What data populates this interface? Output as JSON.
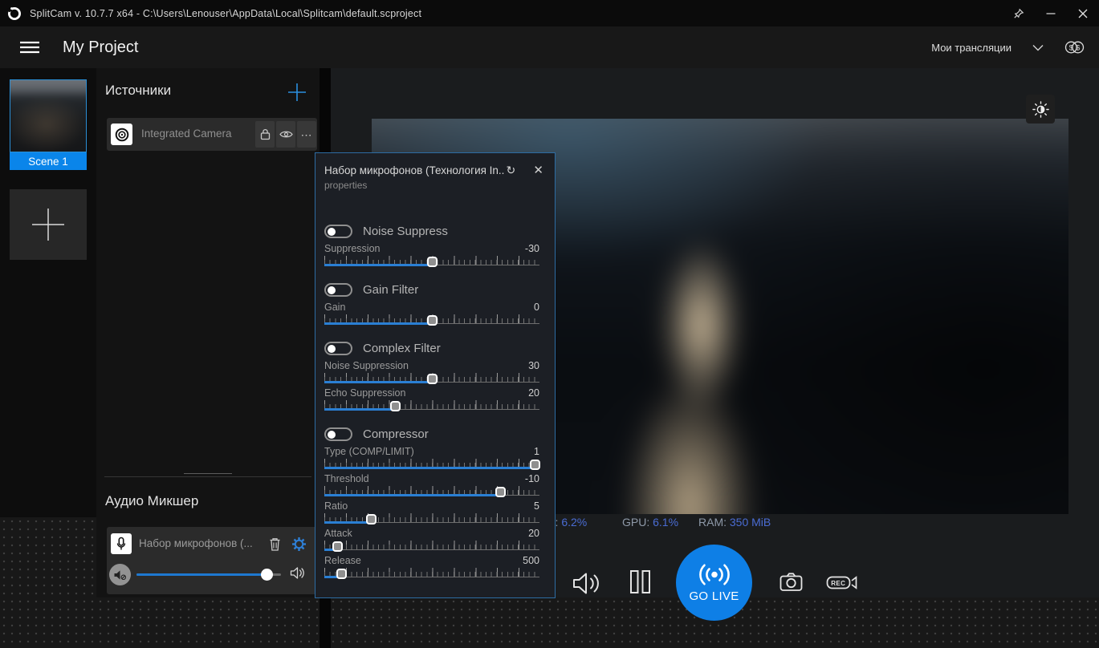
{
  "window": {
    "title": "SplitCam v. 10.7.7 x64 - C:\\Users\\Lenouser\\AppData\\Local\\Splitcam\\default.scproject"
  },
  "header": {
    "title": "My Project",
    "streams_label": "Мои трансляции"
  },
  "scenes": {
    "scene1_label": "Scene 1"
  },
  "sources": {
    "title": "Источники",
    "items": [
      {
        "name": "Integrated Camera"
      }
    ],
    "ellipsis_glyph": "⋯"
  },
  "mixer": {
    "title": "Аудио Микшер",
    "device_name": "Набор микрофонов (...",
    "volume_percent": 90
  },
  "stats": {
    "cpu_label": "CPU:",
    "cpu_value": "6.2%",
    "gpu_label": "GPU:",
    "gpu_value": "6.1%",
    "ram_label": "RAM:",
    "ram_value": "350 MiB"
  },
  "controls": {
    "go_live_label": "GO LIVE",
    "rec_label": "REC"
  },
  "popup": {
    "title": "Набор микрофонов (Технология In..",
    "refresh_glyph": "↻",
    "close_glyph": "✕",
    "subtitle": "properties",
    "sections": [
      {
        "toggle": "Noise Suppress",
        "enabled": false,
        "sliders": [
          {
            "label": "Suppression",
            "value": "-30",
            "percent": 50
          }
        ]
      },
      {
        "toggle": "Gain Filter",
        "enabled": false,
        "sliders": [
          {
            "label": "Gain",
            "value": "0",
            "percent": 50
          }
        ]
      },
      {
        "toggle": "Complex Filter",
        "enabled": false,
        "sliders": [
          {
            "label": "Noise Suppression",
            "value": "30",
            "percent": 50
          },
          {
            "label": "Echo Suppression",
            "value": "20",
            "percent": 33
          }
        ]
      },
      {
        "toggle": "Compressor",
        "enabled": false,
        "sliders": [
          {
            "label": "Type (COMP/LIMIT)",
            "value": "1",
            "percent": 98
          },
          {
            "label": "Threshold",
            "value": "-10",
            "percent": 82
          },
          {
            "label": "Ratio",
            "value": "5",
            "percent": 22
          },
          {
            "label": "Attack",
            "value": "20",
            "percent": 6
          },
          {
            "label": "Release",
            "value": "500",
            "percent": 8
          }
        ]
      }
    ]
  },
  "icons": {
    "dollar": "$"
  },
  "colors": {
    "accent_blue": "#0a85ea",
    "slider_blue": "#2a7fd4",
    "stat_value_blue": "#4a6cd3",
    "popup_border": "#2d6ca3",
    "panel_bg": "#131313",
    "item_bg": "#2b2b2b"
  }
}
